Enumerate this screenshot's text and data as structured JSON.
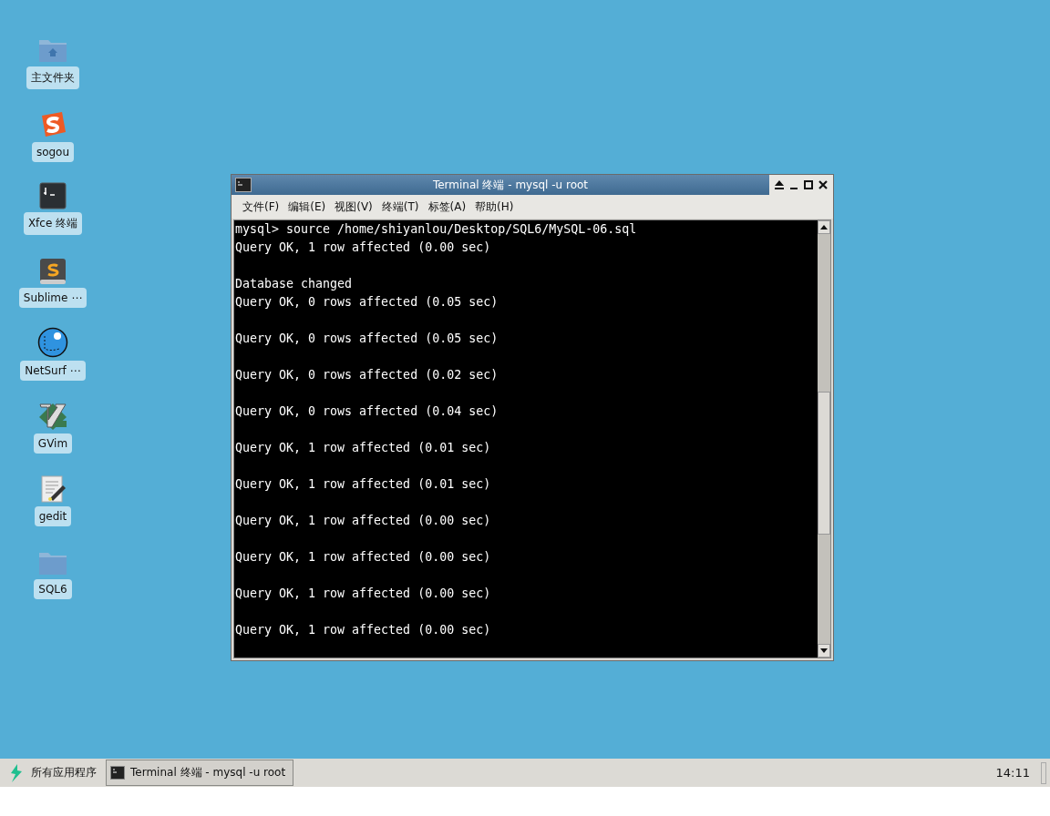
{
  "desktop_icons": [
    {
      "kind": "home-folder",
      "label": "主文件夹"
    },
    {
      "kind": "sogou",
      "label": "sogou"
    },
    {
      "kind": "terminal",
      "label": "Xfce 终端"
    },
    {
      "kind": "sublime",
      "label": "Sublime ⋯"
    },
    {
      "kind": "globe",
      "label": "NetSurf ⋯"
    },
    {
      "kind": "vim",
      "label": "GVim"
    },
    {
      "kind": "editor",
      "label": "gedit"
    },
    {
      "kind": "folder",
      "label": "SQL6"
    }
  ],
  "window": {
    "title": "Terminal 终端 - mysql -u root",
    "menu": [
      "文件(F)",
      "编辑(E)",
      "视图(V)",
      "终端(T)",
      "标签(A)",
      "帮助(H)"
    ],
    "output_blocks": [
      [
        "mysql> source /home/shiyanlou/Desktop/SQL6/MySQL-06.sql",
        "Query OK, 1 row affected (0.00 sec)"
      ],
      [
        "Database changed",
        "Query OK, 0 rows affected (0.05 sec)"
      ],
      [
        "Query OK, 0 rows affected (0.05 sec)"
      ],
      [
        "Query OK, 0 rows affected (0.02 sec)"
      ],
      [
        "Query OK, 0 rows affected (0.04 sec)"
      ],
      [
        "Query OK, 1 row affected (0.01 sec)"
      ],
      [
        "Query OK, 1 row affected (0.01 sec)"
      ],
      [
        "Query OK, 1 row affected (0.00 sec)"
      ],
      [
        "Query OK, 1 row affected (0.00 sec)"
      ],
      [
        "Query OK, 1 row affected (0.00 sec)"
      ],
      [
        "Query OK, 1 row affected (0.00 sec)"
      ]
    ]
  },
  "taskbar": {
    "apps_menu": "所有应用程序",
    "tasks": [
      {
        "label": "Terminal 终端 - mysql -u root",
        "selected": true
      }
    ],
    "clock": "14:11"
  }
}
